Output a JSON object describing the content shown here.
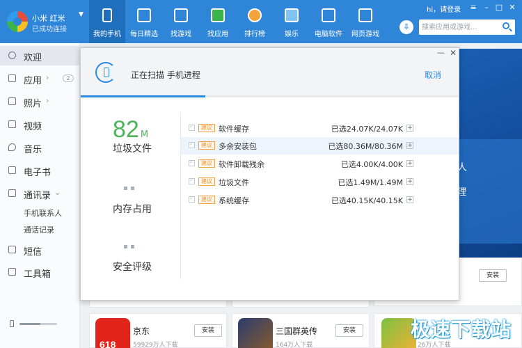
{
  "device": {
    "name": "小米 红米",
    "status": "已成功连接"
  },
  "nav": [
    {
      "label": "我的手机",
      "icon": "phone-icon"
    },
    {
      "label": "每日精选",
      "icon": "calendar-icon"
    },
    {
      "label": "找游戏",
      "icon": "gamepad-icon"
    },
    {
      "label": "找应用",
      "icon": "shopping-bag-icon"
    },
    {
      "label": "排行榜",
      "icon": "medal-icon"
    },
    {
      "label": "娱乐",
      "icon": "folder-icon"
    },
    {
      "label": "电脑软件",
      "icon": "monitor-icon"
    },
    {
      "label": "网页游戏",
      "icon": "web-game-icon"
    }
  ],
  "topright": {
    "user": "hi，请登录",
    "search_placeholder": "搜索应用或游戏..."
  },
  "sidebar": {
    "items": [
      {
        "label": "欢迎",
        "icon": "welcome-icon"
      },
      {
        "label": "应用",
        "icon": "apps-icon",
        "arrow": "›",
        "badge": "2"
      },
      {
        "label": "照片",
        "icon": "photo-icon",
        "arrow": "›"
      },
      {
        "label": "视频",
        "icon": "video-icon"
      },
      {
        "label": "音乐",
        "icon": "music-icon"
      },
      {
        "label": "电子书",
        "icon": "book-icon"
      },
      {
        "label": "通讯录",
        "icon": "contacts-icon",
        "arrow": "⌄"
      },
      {
        "label": "短信",
        "icon": "sms-icon"
      },
      {
        "label": "工具箱",
        "icon": "toolbox-icon"
      }
    ],
    "sub": [
      "手机联系人",
      "通话记录"
    ],
    "storage_fraction": 0.55
  },
  "modal": {
    "title": "正在扫描 手机进程",
    "cancel": "取消",
    "progress": 0.33,
    "junk_value": "82",
    "junk_unit": "M",
    "junk_label": "垃圾文件",
    "memory_label": "内存占用",
    "security_label": "安全评级",
    "tag": "建议",
    "rows": [
      {
        "name": "软件缓存",
        "value": "已选24.07K/24.07K"
      },
      {
        "name": "多余安装包",
        "value": "已选80.36M/80.36M"
      },
      {
        "name": "软件卸载残余",
        "value": "已选4.00K/4.00K"
      },
      {
        "name": "垃圾文件",
        "value": "已选1.49M/1.49M"
      },
      {
        "name": "系统缓存",
        "value": "已选40.15K/40.15K"
      }
    ]
  },
  "background": {
    "banner_text1": "人",
    "banner_text2": "理",
    "install": "安装",
    "apps": [
      {
        "name": "京东",
        "downloads": "59929万人下载",
        "badge": "618"
      },
      {
        "name": "三国群英传",
        "downloads": "164万人下载"
      },
      {
        "name": "",
        "downloads": "26万人下载"
      }
    ]
  },
  "watermark": "极速下载站"
}
